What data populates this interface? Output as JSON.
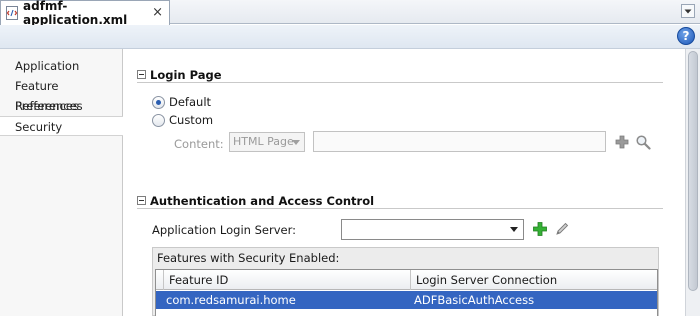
{
  "editor_tab": {
    "title": "adfmf-application.xml",
    "close_glyph": "×",
    "icon": "xml-file-icon",
    "menu_icon": "tab-menu-icon"
  },
  "toolbar": {
    "help_label": "?"
  },
  "sidebar": {
    "items": [
      {
        "label": "Application",
        "selected": false
      },
      {
        "label": "Feature References",
        "selected": false
      },
      {
        "label": "Preferences",
        "selected": false
      },
      {
        "label": "Security",
        "selected": true
      }
    ]
  },
  "login_page": {
    "title": "Login Page",
    "options": [
      {
        "label": "Default",
        "checked": true
      },
      {
        "label": "Custom",
        "checked": false
      }
    ],
    "content_label": "Content:",
    "content_type": "HTML Page",
    "content_value": "",
    "add_icon": "add-icon",
    "search_icon": "search-icon"
  },
  "auth": {
    "title": "Authentication and Access Control",
    "server_label": "Application Login Server:",
    "server_value": "",
    "add_icon": "add-icon",
    "edit_icon": "edit-icon",
    "features_title": "Features with Security Enabled:",
    "columns": [
      "Feature ID",
      "Login Server Connection"
    ],
    "rows": [
      {
        "feature_id": "com.redsamurai.home",
        "connection": "ADFBasicAuthAccess",
        "selected": true
      }
    ]
  },
  "colors": {
    "selection": "#3465c1",
    "add_green": "#2e9b2e",
    "help_blue": "#1c56b8"
  }
}
